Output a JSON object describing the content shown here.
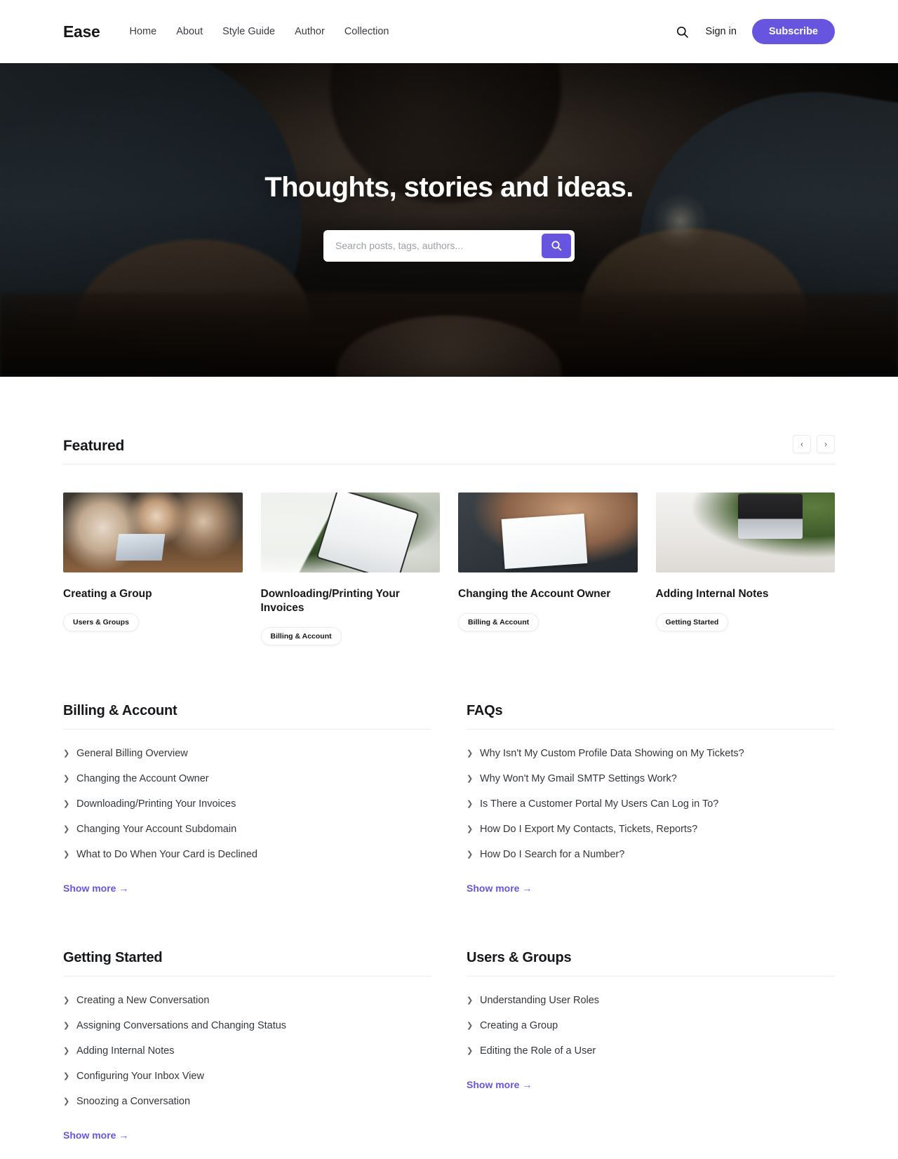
{
  "header": {
    "brand": "Ease",
    "nav": [
      {
        "label": "Home"
      },
      {
        "label": "About"
      },
      {
        "label": "Style Guide"
      },
      {
        "label": "Author"
      },
      {
        "label": "Collection"
      }
    ],
    "search_icon": "search-icon",
    "signin_label": "Sign in",
    "subscribe_label": "Subscribe",
    "accent_color": "#6755e0"
  },
  "hero": {
    "title": "Thoughts, stories and ideas.",
    "search_placeholder": "Search posts, tags, authors...",
    "search_value": "",
    "search_button_icon": "search-icon"
  },
  "featured": {
    "title": "Featured",
    "prev_icon": "chevron-left-icon",
    "next_icon": "chevron-right-icon",
    "cards": [
      {
        "title": "Creating a Group",
        "tag": "Users & Groups"
      },
      {
        "title": "Downloading/Printing Your Invoices",
        "tag": "Billing & Account"
      },
      {
        "title": "Changing the Account Owner",
        "tag": "Billing & Account"
      },
      {
        "title": "Adding Internal Notes",
        "tag": "Getting Started"
      }
    ]
  },
  "categories": [
    {
      "title": "Billing & Account",
      "items": [
        "General Billing Overview",
        "Changing the Account Owner",
        "Downloading/Printing Your Invoices",
        "Changing Your Account Subdomain",
        "What to Do When Your Card is Declined"
      ],
      "show_more": "Show more →"
    },
    {
      "title": "FAQs",
      "items": [
        "Why Isn't My Custom Profile Data Showing on My Tickets?",
        "Why Won't My Gmail SMTP Settings Work?",
        "Is There a Customer Portal My Users Can Log in To?",
        "How Do I Export My Contacts, Tickets, Reports?",
        "How Do I Search for a Number?"
      ],
      "show_more": "Show more →"
    },
    {
      "title": "Getting Started",
      "items": [
        "Creating a New Conversation",
        "Assigning Conversations and Changing Status",
        "Adding Internal Notes",
        "Configuring Your Inbox View",
        "Snoozing a Conversation"
      ],
      "show_more": "Show more →"
    },
    {
      "title": "Users & Groups",
      "items": [
        "Understanding User Roles",
        "Creating a Group",
        "Editing the Role of a User"
      ],
      "show_more": "Show more →"
    }
  ]
}
